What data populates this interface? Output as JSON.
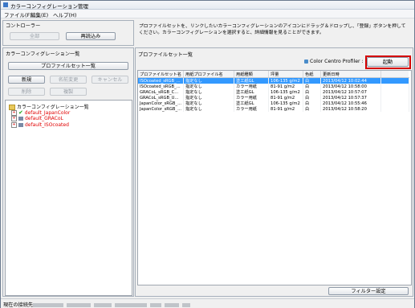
{
  "window": {
    "title": "カラーコンフィグレーション管理"
  },
  "menu": {
    "items": [
      "ファイル(F)",
      "編集(E)",
      "ヘルプ(H)"
    ]
  },
  "controller": {
    "title": "コントローラー",
    "buttons": [
      "全部",
      "再読込み"
    ],
    "description": "プロファイルセットを、リンクしたいカラーコンフィグレーションのアイコンにドラッグ＆ドロップし、「登録」ボタンを押してください。カラーコンフィグレーションを選択すると、詳細情報を見ることができます。"
  },
  "left": {
    "title": "カラーコンフィグレーション一覧",
    "profile_set_button": "プロファイルセット一覧",
    "buttons_row1": [
      "新規",
      "名前変更",
      "キャンセル"
    ],
    "buttons_row2": [
      "削除",
      "複製"
    ],
    "tree_root": "カラーコンフィグレーション一覧",
    "tree_items": [
      "default_JapanColor",
      "default_GRACoL",
      "default_ISOcoated"
    ]
  },
  "right": {
    "title": "プロファイルセット一覧",
    "profiler_label": "Color Centro Profiler :",
    "launch_button": "起動",
    "columns": [
      "プロファイルセット名",
      "用紙プロファイル名",
      "用紙種類",
      "坪量",
      "色紙",
      "更新日時"
    ],
    "rows": [
      [
        "ISOcoated_sRGB_...",
        "指定なし",
        "塗工紙GL",
        "106-135 g/m2",
        "白",
        "2013/04/12 10:02:44"
      ],
      [
        "ISOcoated_sRGB_...",
        "指定なし",
        "カラー用紙",
        "81-91 g/m2",
        "白",
        "2013/04/12 10:58:00"
      ],
      [
        "GRACoL_sRGB_C...",
        "指定なし",
        "塗工紙GL",
        "106-135 g/m2",
        "白",
        "2013/04/12 10:57:07"
      ],
      [
        "GRACoL_sRGB_U...",
        "指定なし",
        "カラー用紙",
        "81-91 g/m2",
        "白",
        "2013/04/12 10:57:37"
      ],
      [
        "JapanColor_sRGB_...",
        "指定なし",
        "塗工紙GL",
        "106-135 g/m2",
        "白",
        "2013/04/12 10:55:46"
      ],
      [
        "JapanColor_sRGB_...",
        "指定なし",
        "カラー用紙",
        "81-91 g/m2",
        "白",
        "2013/04/12 10:58:20"
      ]
    ],
    "selected_row": 0,
    "filter_button": "フィルター設定"
  },
  "status": {
    "label": "現在の接続先"
  },
  "colors": {
    "selected": "#3399ff",
    "tree_item_red": "#e00000",
    "highlight_box": "#d40000"
  }
}
